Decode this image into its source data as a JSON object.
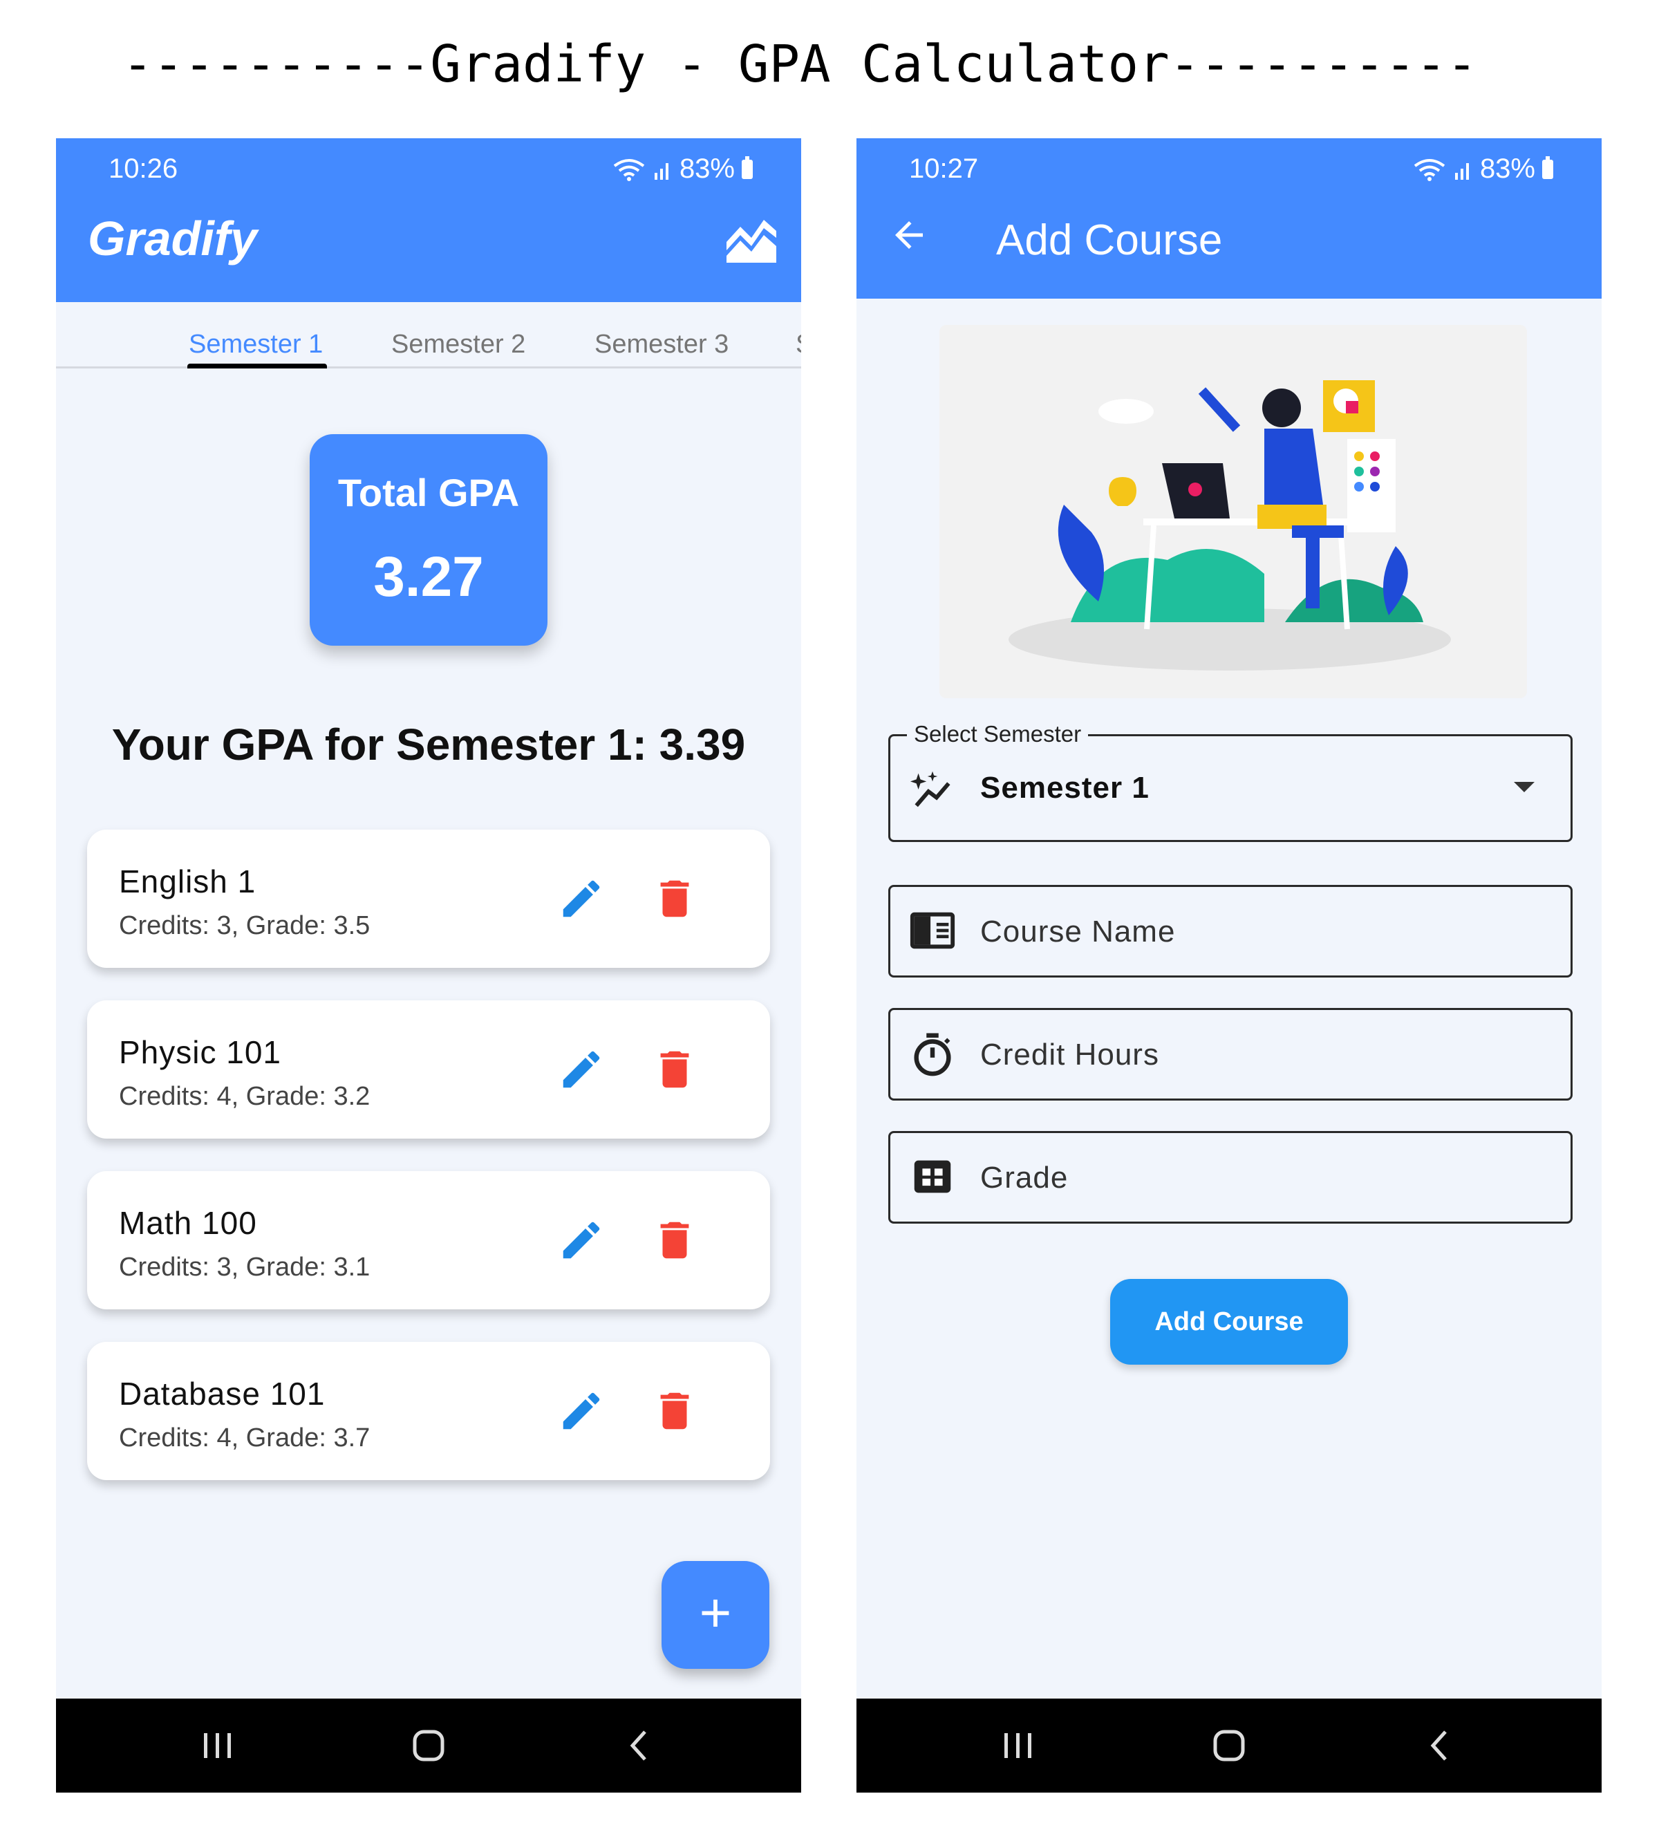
{
  "heading": "----------Gradify - GPA Calculator----------",
  "screen1": {
    "status": {
      "time": "10:26",
      "battery": "83%"
    },
    "app_title": "Gradify",
    "tabs": [
      {
        "label": "Semester 1"
      },
      {
        "label": "Semester 2"
      },
      {
        "label": "Semester 3"
      },
      {
        "label": "S"
      }
    ],
    "total_gpa": {
      "label": "Total GPA",
      "value": "3.27"
    },
    "semester_gpa": "Your GPA for Semester 1: 3.39",
    "courses": [
      {
        "name": "English 1",
        "info": "Credits: 3, Grade: 3.5"
      },
      {
        "name": "Physic 101",
        "info": "Credits: 4, Grade: 3.2"
      },
      {
        "name": "Math 100",
        "info": "Credits: 3, Grade: 3.1"
      },
      {
        "name": "Database 101",
        "info": "Credits: 4, Grade: 3.7"
      }
    ],
    "fab_label": "+"
  },
  "screen2": {
    "status": {
      "time": "10:27",
      "battery": "83%"
    },
    "title": "Add Course",
    "semester_field": {
      "label": "Select Semester",
      "value": "Semester 1"
    },
    "course_name_placeholder": "Course Name",
    "credit_hours_placeholder": "Credit Hours",
    "grade_placeholder": "Grade",
    "submit_label": "Add Course"
  },
  "colors": {
    "primary": "#448aff",
    "edit": "#1e88e5",
    "delete": "#f44336",
    "button": "#2196f3",
    "background": "#f1f5fc"
  },
  "icons": [
    "chart-icon",
    "edit-icon",
    "delete-icon",
    "add-icon",
    "back-arrow-icon",
    "sparkle-chart-icon",
    "book-icon",
    "timer-icon",
    "grid-icon",
    "wifi-icon",
    "signal-icon",
    "battery-icon"
  ]
}
